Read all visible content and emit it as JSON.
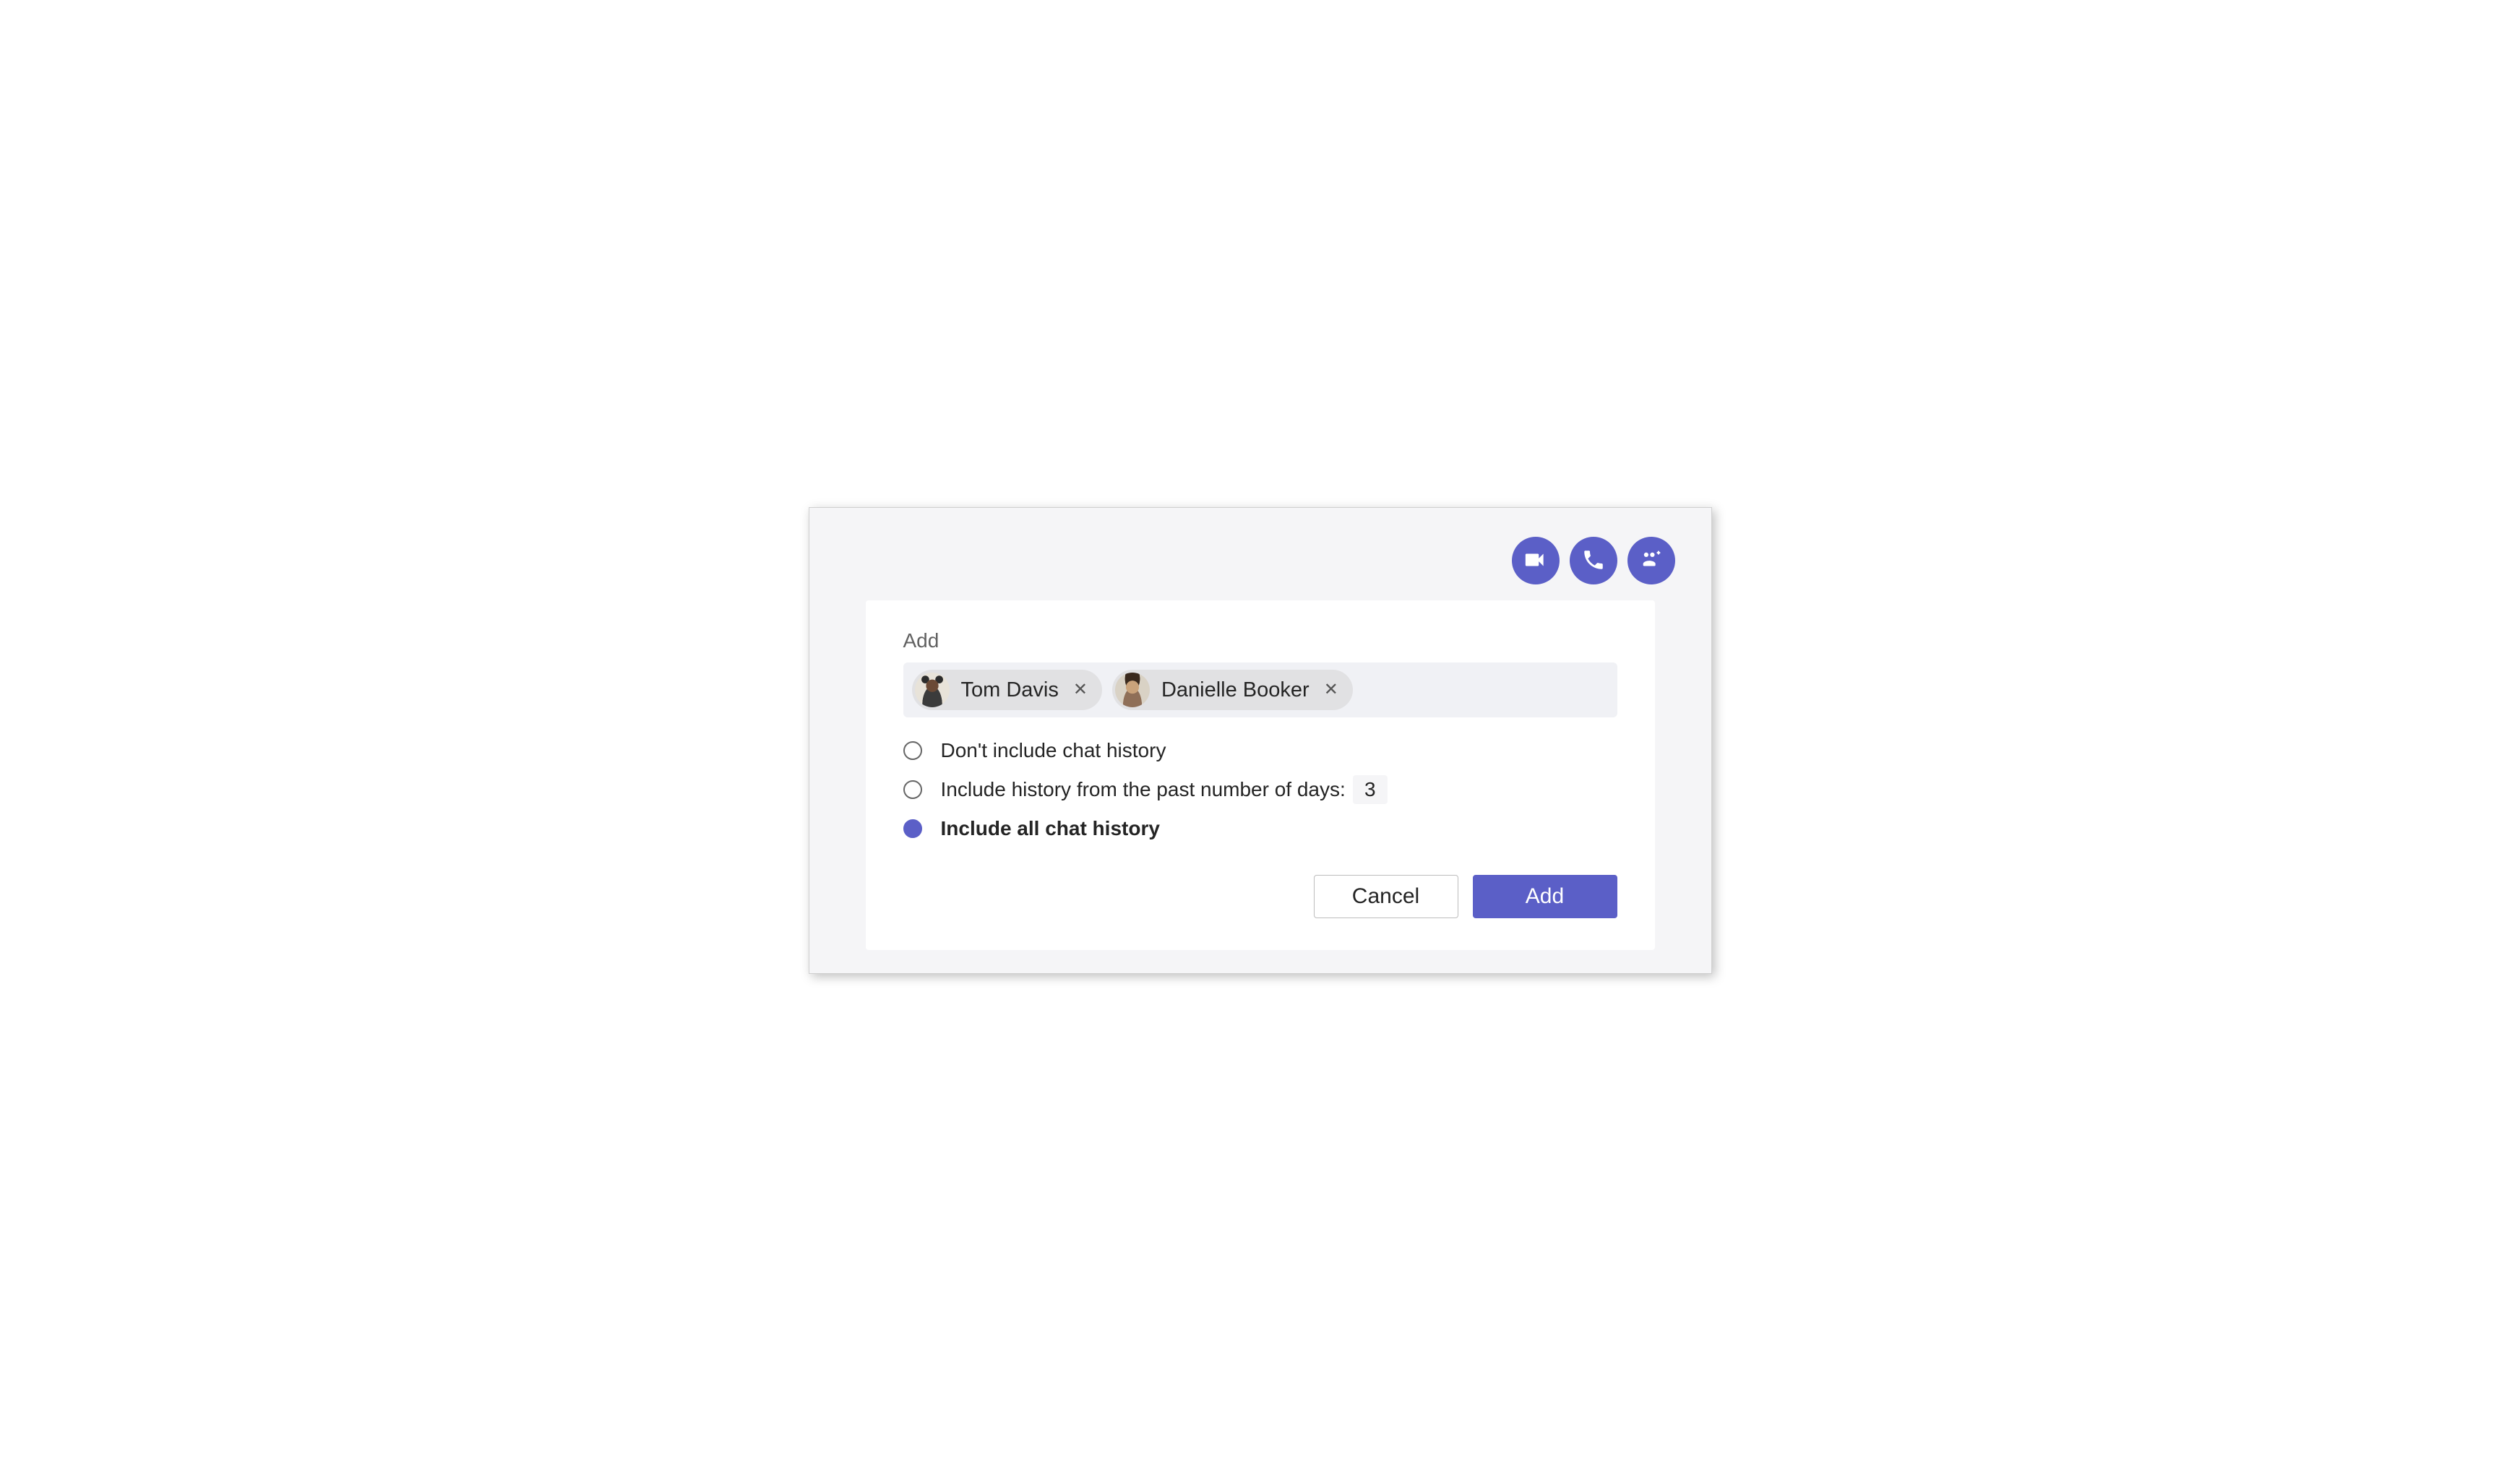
{
  "toolbar": {
    "video_icon": "video-call",
    "audio_icon": "audio-call",
    "add_people_icon": "add-people"
  },
  "panel": {
    "title": "Add"
  },
  "people": [
    {
      "name": "Tom Davis"
    },
    {
      "name": "Danielle Booker"
    }
  ],
  "history_options": {
    "none": "Don't include chat history",
    "days_label": "Include history from the past number of days:",
    "days_value": "3",
    "all": "Include all chat history",
    "selected": "all"
  },
  "buttons": {
    "cancel": "Cancel",
    "add": "Add"
  }
}
